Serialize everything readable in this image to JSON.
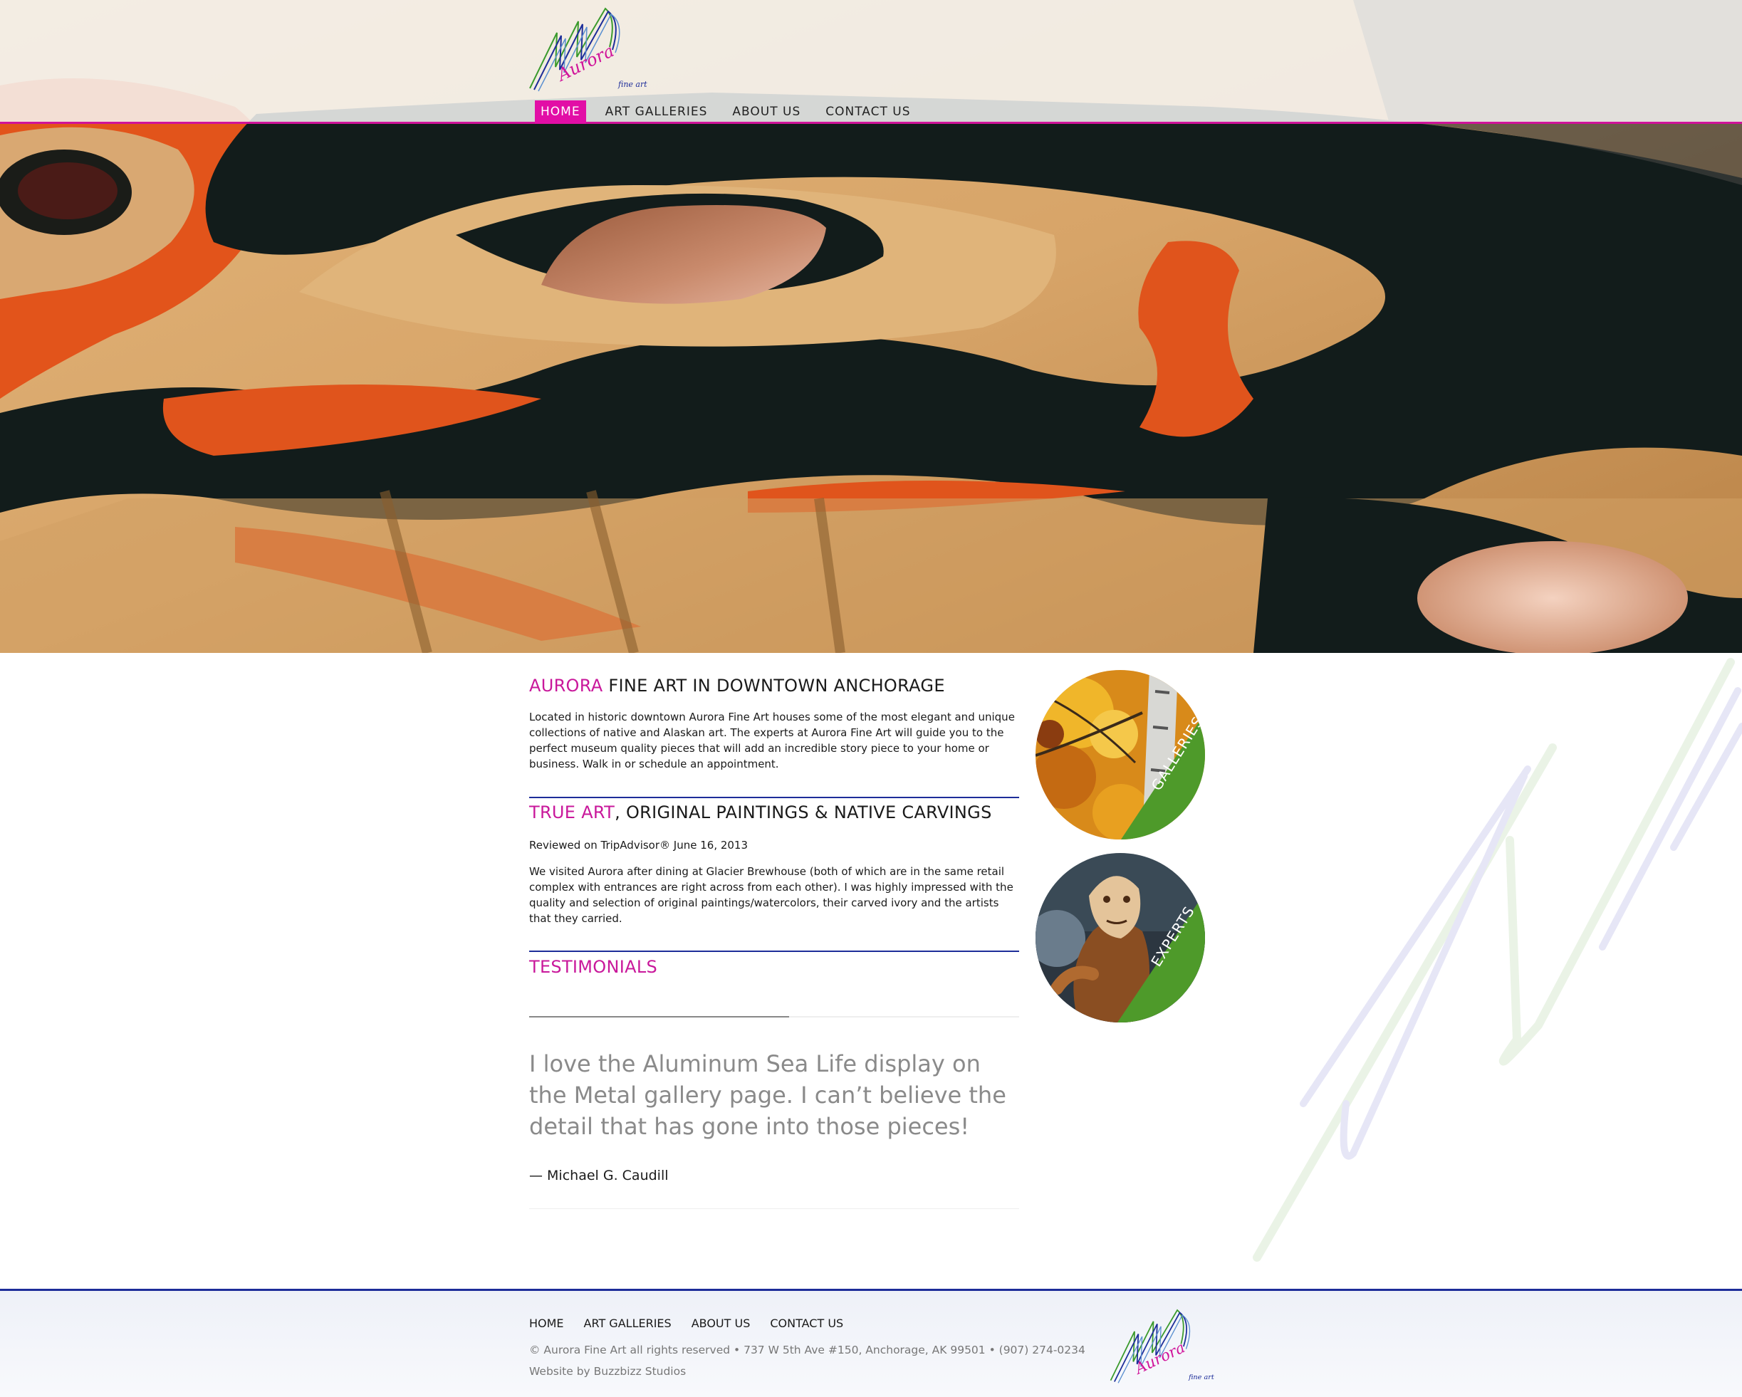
{
  "header": {
    "logo_word": "Aurora",
    "logo_sub": "fine art",
    "nav": [
      "HOME",
      "ART GALLERIES",
      "ABOUT US",
      "CONTACT US"
    ],
    "active_nav": "HOME"
  },
  "main": {
    "intro": {
      "title_accent": "AURORA",
      "title_rest": " FINE ART IN DOWNTOWN ANCHORAGE",
      "text": "Located in historic downtown Aurora Fine Art houses some of the most elegant and unique collections of native and Alaskan art. The experts at Aurora Fine Art will guide you to the perfect museum quality pieces that will add an incredible story piece to your home or business. Walk in or schedule an appointment."
    },
    "review": {
      "title_accent": "TRUE ART",
      "title_rest": ", ORIGINAL PAINTINGS & NATIVE CARVINGS",
      "meta": "Reviewed on TripAdvisor® June 16, 2013",
      "text": "We visited Aurora after dining at Glacier Brewhouse (both of which are in the same retail complex with entrances are right across from each other). I was highly impressed with the quality and selection of original paintings/watercolors, their carved ivory and the artists that they carried."
    },
    "testimonials": {
      "title": "TESTIMONIALS",
      "slider_progress": 0.53,
      "quote": "I love the Aluminum Sea Life display on the Metal gallery page. I can’t believe the detail that has gone into those pieces!",
      "author": "— Michael G. Caudill"
    }
  },
  "sidebar": {
    "circles": [
      {
        "label": "GALLERIES",
        "accent_color": "#4e9a2a"
      },
      {
        "label": "EXPERTS",
        "accent_color": "#4e9a2a"
      }
    ]
  },
  "footer": {
    "nav": [
      "HOME",
      "ART GALLERIES",
      "ABOUT US",
      "CONTACT US"
    ],
    "copyright": "© Aurora Fine Art all rights reserved • 737 W 5th Ave #150, Anchorage, AK 99501 • (907) 274-0234",
    "credit": "Website by Buzzbizz Studios"
  },
  "colors": {
    "accent_magenta": "#c9189b",
    "nav_active_bg": "#e20ea6",
    "rule_blue": "#1d2d99",
    "circle_green": "#4e9a2a"
  }
}
